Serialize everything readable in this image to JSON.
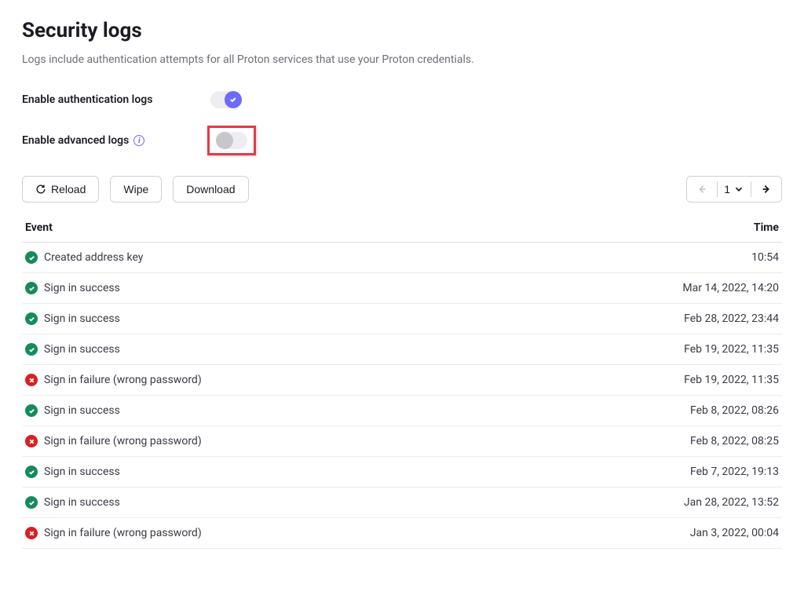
{
  "title": "Security logs",
  "description": "Logs include authentication attempts for all Proton services that use your Proton credentials.",
  "settings": {
    "auth_logs_label": "Enable authentication logs",
    "auth_logs_on": true,
    "advanced_logs_label": "Enable advanced logs",
    "advanced_logs_on": false
  },
  "toolbar": {
    "reload": "Reload",
    "wipe": "Wipe",
    "download": "Download"
  },
  "pagination": {
    "page": "1"
  },
  "table": {
    "headers": {
      "event": "Event",
      "time": "Time"
    },
    "rows": [
      {
        "status": "success",
        "event": "Created address key",
        "time": "10:54"
      },
      {
        "status": "success",
        "event": "Sign in success",
        "time": "Mar 14, 2022, 14:20"
      },
      {
        "status": "success",
        "event": "Sign in success",
        "time": "Feb 28, 2022, 23:44"
      },
      {
        "status": "success",
        "event": "Sign in success",
        "time": "Feb 19, 2022, 11:35"
      },
      {
        "status": "failure",
        "event": "Sign in failure (wrong password)",
        "time": "Feb 19, 2022, 11:35"
      },
      {
        "status": "success",
        "event": "Sign in success",
        "time": "Feb 8, 2022, 08:26"
      },
      {
        "status": "failure",
        "event": "Sign in failure (wrong password)",
        "time": "Feb 8, 2022, 08:25"
      },
      {
        "status": "success",
        "event": "Sign in success",
        "time": "Feb 7, 2022, 19:13"
      },
      {
        "status": "success",
        "event": "Sign in success",
        "time": "Jan 28, 2022, 13:52"
      },
      {
        "status": "failure",
        "event": "Sign in failure (wrong password)",
        "time": "Jan 3, 2022, 00:04"
      }
    ]
  }
}
